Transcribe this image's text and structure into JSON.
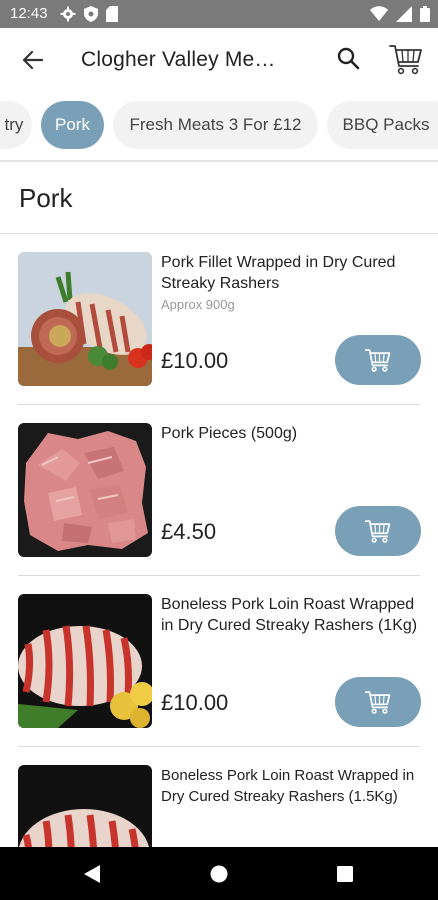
{
  "status_bar": {
    "time": "12:43",
    "left_icons": [
      "gear-icon",
      "shield-icon",
      "sd-card-icon"
    ],
    "right_icons": [
      "wifi-icon",
      "signal-icon",
      "battery-icon"
    ]
  },
  "app_bar": {
    "title": "Clogher Valley Me…",
    "back_icon": "arrow-left-icon",
    "search_icon": "search-icon",
    "cart_icon": "shopping-cart-icon"
  },
  "categories": [
    {
      "label": "try",
      "active": false
    },
    {
      "label": "Pork",
      "active": true
    },
    {
      "label": "Fresh Meats 3 For £12",
      "active": false
    },
    {
      "label": "BBQ Packs",
      "active": false
    }
  ],
  "section_title": "Pork",
  "products": [
    {
      "name": "Pork Fillet Wrapped in Dry Cured Streaky Rashers",
      "subtitle": "Approx 900g",
      "price": "£10.00",
      "image": "pork-fillet-wrapped-image"
    },
    {
      "name": "Pork Pieces (500g)",
      "subtitle": "",
      "price": "£4.50",
      "image": "pork-pieces-image"
    },
    {
      "name": "Boneless Pork Loin Roast Wrapped in Dry Cured Streaky Rashers (1Kg)",
      "subtitle": "",
      "price": "£10.00",
      "image": "pork-loin-roast-image"
    },
    {
      "name": "Boneless Pork Loin Roast Wrapped in Dry Cured Streaky Rashers (1.5Kg)",
      "subtitle": "",
      "price": "",
      "image": "pork-loin-roast-image"
    }
  ],
  "colors": {
    "accent": "#7aa0b8",
    "status_bar": "#7a7a7a",
    "chip_bg": "#f2f2f2",
    "nav_bar": "#000000"
  },
  "nav_bar": {
    "icons": [
      "back-triangle-icon",
      "home-circle-icon",
      "recents-square-icon"
    ]
  }
}
